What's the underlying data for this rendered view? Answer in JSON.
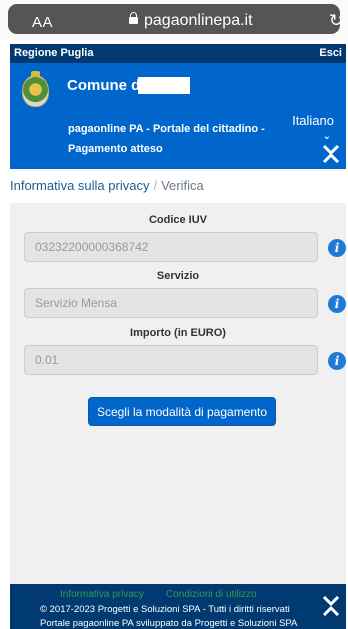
{
  "browser": {
    "text_size_label": "AA",
    "url": "pagaonlinepa.it",
    "icons": {
      "lock": "lock-icon",
      "reload": "reload-icon"
    }
  },
  "region": {
    "label": "Regione Puglia",
    "logout_label": "Esci"
  },
  "header": {
    "comune_label": "Comune di",
    "portal_title": "pagaonline PA - Portale del cittadino -",
    "page_subtitle": "Pagamento atteso",
    "language": "Italiano",
    "icons": {
      "crest": "municipal-crest-icon",
      "collapse": "collapse-icon"
    }
  },
  "breadcrumb": {
    "items": [
      "Informativa sulla privacy",
      "Verifica"
    ],
    "separator": "/"
  },
  "form": {
    "fields": [
      {
        "label": "Codice IUV",
        "value": "03232200000368742"
      },
      {
        "label": "Servizio",
        "value": "Servizio Mensa"
      },
      {
        "label": "Importo (in EURO)",
        "value": "0.01"
      }
    ],
    "info_icon": "info-icon",
    "submit_label": "Scegli la modalità di pagamento"
  },
  "footer": {
    "links": [
      "Informativa privacy",
      "Condizioni di utilizzo"
    ],
    "copyright": "© 2017-2023 Progetti e Soluzioni SPA - Tutti i diritti riservati",
    "credit": "Portale pagaonline PA sviluppato da Progetti e Soluzioni SPA"
  },
  "colors": {
    "brand_blue": "#0066cc",
    "dark_navy": "#003a70",
    "footer_link_green": "#2e9c57",
    "info_blue": "#1f7bd6"
  }
}
